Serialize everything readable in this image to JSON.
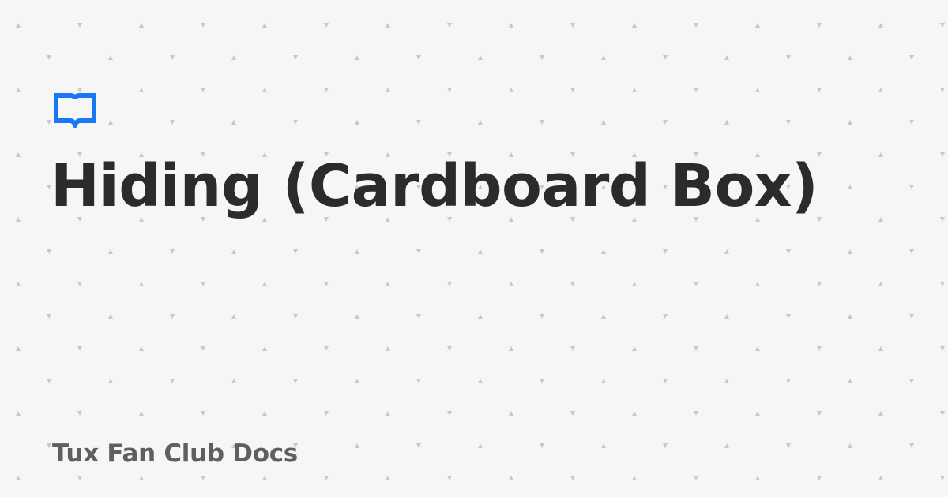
{
  "page": {
    "title": "Hiding (Cardboard Box)",
    "site_name": "Tux Fan Club Docs"
  },
  "logo": {
    "icon": "book-icon"
  },
  "colors": {
    "background": "#f6f6f6",
    "pattern_dot": "#c8c8c8",
    "accent": "#1877f2",
    "title": "#2b2b2b",
    "site_name": "#5f5f5f"
  }
}
